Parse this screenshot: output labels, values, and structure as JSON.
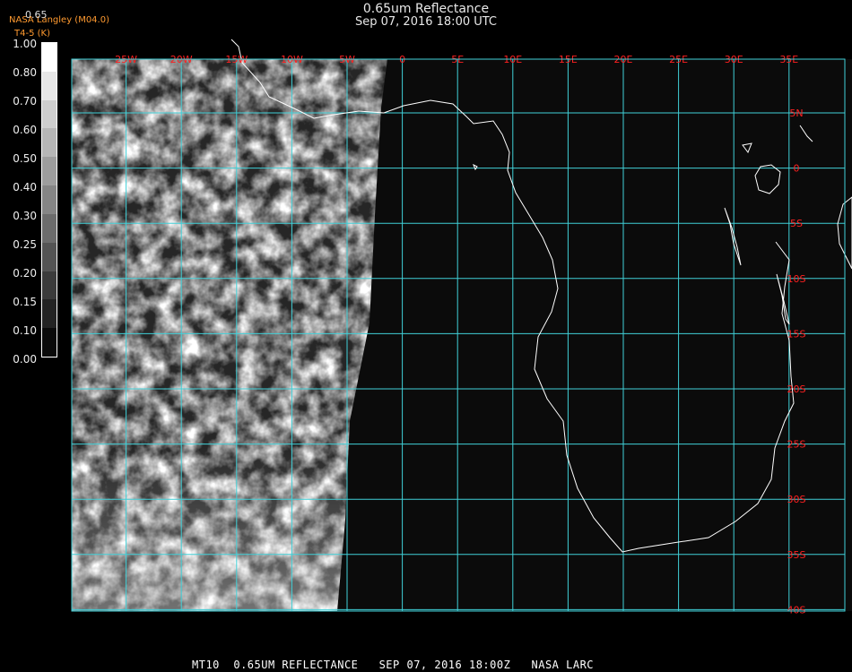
{
  "header": {
    "title": "0.65um Reflectance",
    "subtitle": "Sep 07, 2016 18:00 UTC",
    "credit": "NASA Langley (M04.0)",
    "sublabel": "T4-5 (K)",
    "scale_top": "0.65"
  },
  "colorbar": {
    "ticks": [
      "1.00",
      "0.80",
      "0.70",
      "0.60",
      "0.50",
      "0.40",
      "0.30",
      "0.25",
      "0.20",
      "0.15",
      "0.10",
      "0.00"
    ]
  },
  "map": {
    "lon_labels": [
      "25W",
      "20W",
      "15W",
      "10W",
      "5W",
      "0",
      "5E",
      "10E",
      "15E",
      "20E",
      "25E",
      "30E",
      "35E"
    ],
    "lat_labels": [
      "5N",
      "0",
      "5S",
      "10S",
      "15S",
      "20S",
      "25S",
      "30S",
      "35S",
      "40S"
    ],
    "grid_color": "#40d0d8",
    "label_color": "#ff2020",
    "coast_color": "#ffffff",
    "space_color": "#0b0b0b"
  },
  "footer": {
    "text": "MT10  0.65UM REFLECTANCE   SEP 07, 2016 18:00Z   NASA LARC"
  }
}
